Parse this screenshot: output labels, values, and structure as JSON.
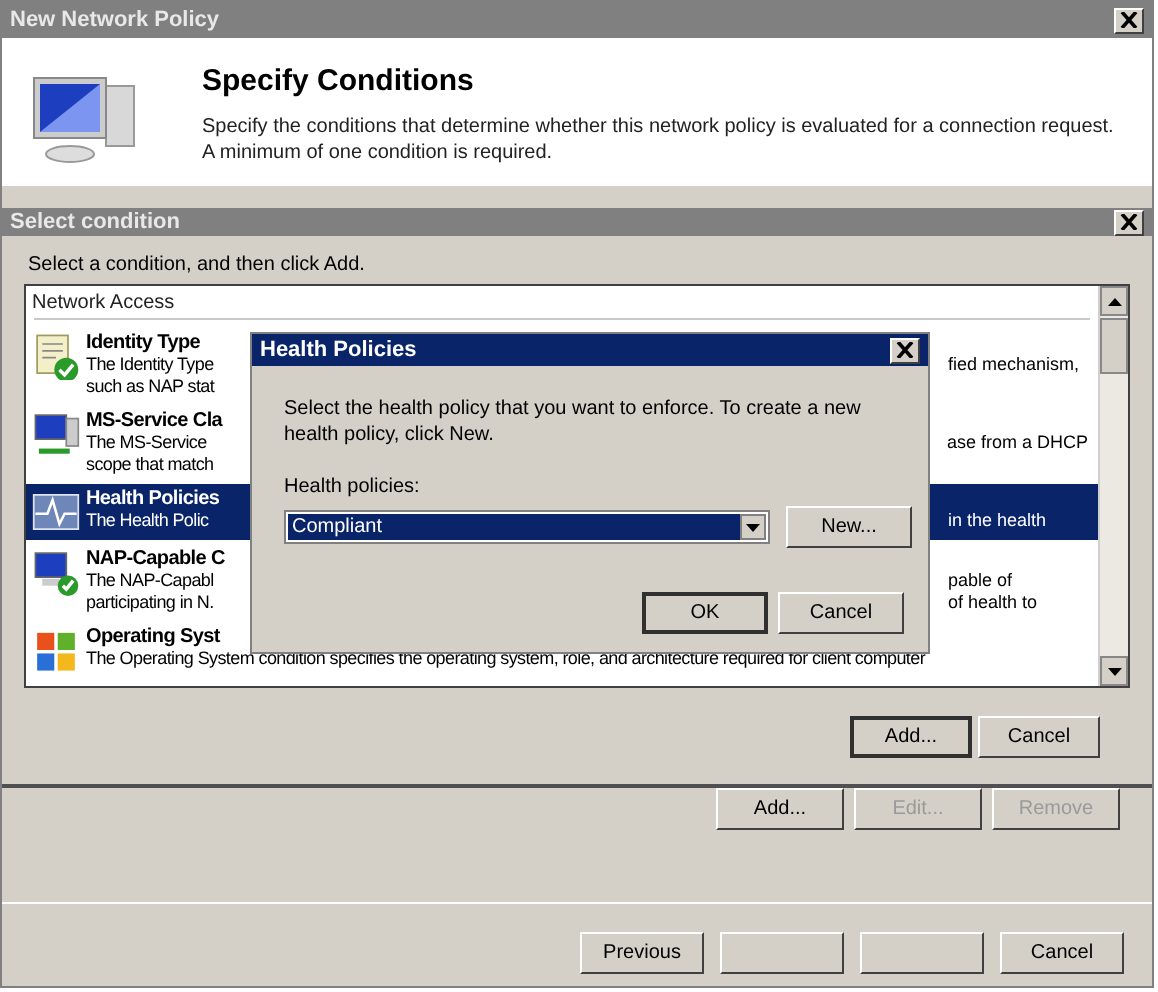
{
  "window": {
    "title": "New Network Policy"
  },
  "header": {
    "title": "Specify Conditions",
    "description": "Specify the conditions that determine whether this network policy is evaluated for a connection request. A minimum of one condition is required."
  },
  "select_dialog": {
    "title": "Select condition",
    "instruction": "Select a condition, and then click Add.",
    "group": "Network Access",
    "items": [
      {
        "kind": "identity",
        "title": "Identity Type",
        "lines": [
          {
            "left": "The Identity Type",
            "right": "fied mechanism,"
          },
          {
            "left": "such as NAP stat"
          }
        ],
        "selected": false
      },
      {
        "kind": "service",
        "title": "MS-Service Cla",
        "lines": [
          {
            "left": "The MS-Service",
            "right": "ase from a DHCP"
          },
          {
            "left": "scope that match"
          }
        ],
        "selected": false
      },
      {
        "kind": "health",
        "title": "Health Policies",
        "lines": [
          {
            "left": "The Health Polic",
            "right": "in the health"
          }
        ],
        "selected": true
      },
      {
        "kind": "nap",
        "title": "NAP-Capable C",
        "lines": [
          {
            "left": "The NAP-Capabl",
            "right": "pable of"
          },
          {
            "left": "participating in N.",
            "right": "of health to"
          }
        ],
        "selected": false
      },
      {
        "kind": "os",
        "title": "Operating Syst",
        "lines": [
          {
            "full": "The Operating System condition specifies the operating system, role, and architecture required for client computer"
          }
        ],
        "selected": false
      }
    ],
    "buttons": [
      {
        "label": "Add...",
        "default": true
      },
      {
        "label": "Cancel",
        "default": false
      }
    ]
  },
  "health_dialog": {
    "title": "Health Policies",
    "description": "Select the health policy that you want to enforce. To create a new health policy, click New.",
    "field_label": "Health policies:",
    "value": "Compliant",
    "new_button": "New...",
    "buttons": [
      {
        "label": "OK",
        "default": true
      },
      {
        "label": "Cancel",
        "default": false
      }
    ]
  },
  "condition_buttons": [
    {
      "label": "Add...",
      "disabled": false
    },
    {
      "label": "Edit...",
      "disabled": true
    },
    {
      "label": "Remove",
      "disabled": true
    }
  ],
  "footer_buttons": [
    {
      "kind": "labeled",
      "label": "Previous"
    },
    {
      "kind": "blank"
    },
    {
      "kind": "blank"
    },
    {
      "kind": "labeled",
      "label": "Cancel"
    }
  ]
}
